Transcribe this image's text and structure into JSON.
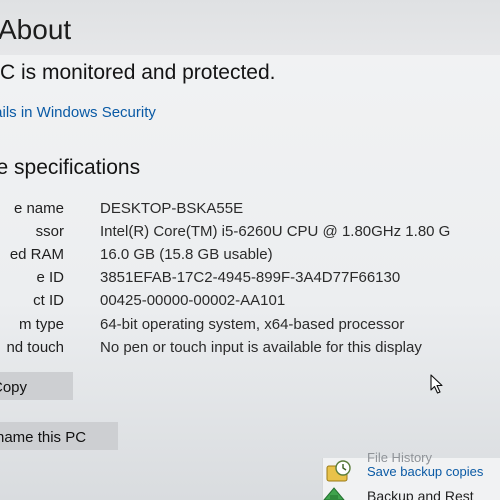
{
  "header": {
    "title": "About"
  },
  "security": {
    "status": "PC is monitored and protected.",
    "link": "tails in Windows Security"
  },
  "device_specs": {
    "heading": "ce specifications",
    "rows": [
      {
        "label": "e name",
        "value": "DESKTOP-BSKA55E"
      },
      {
        "label": "ssor",
        "value": "Intel(R) Core(TM) i5-6260U CPU @ 1.80GHz   1.80 G"
      },
      {
        "label": "ed RAM",
        "value": "16.0 GB (15.8 GB usable)"
      },
      {
        "label": "e ID",
        "value": "3851EFAB-17C2-4945-899F-3A4D77F66130"
      },
      {
        "label": "ct ID",
        "value": "00425-00000-00002-AA101"
      },
      {
        "label": "m type",
        "value": "64-bit operating system, x64-based processor"
      },
      {
        "label": "nd touch",
        "value": "No pen or touch input is available for this display"
      }
    ]
  },
  "actions": {
    "copy_label": "Copy",
    "rename_label": "name this PC"
  },
  "related": {
    "file_history_title": "File History",
    "save_backup_link": "Save backup copies",
    "backup_restore": "Backup and Rest"
  },
  "icons": {
    "cursor": "mouse-pointer-icon",
    "history": "file-history-icon",
    "backup": "backup-restore-icon"
  },
  "colors": {
    "link": "#0a5aa5",
    "button_bg": "#cdcfd2",
    "window_bg": "#f2f3f4"
  }
}
